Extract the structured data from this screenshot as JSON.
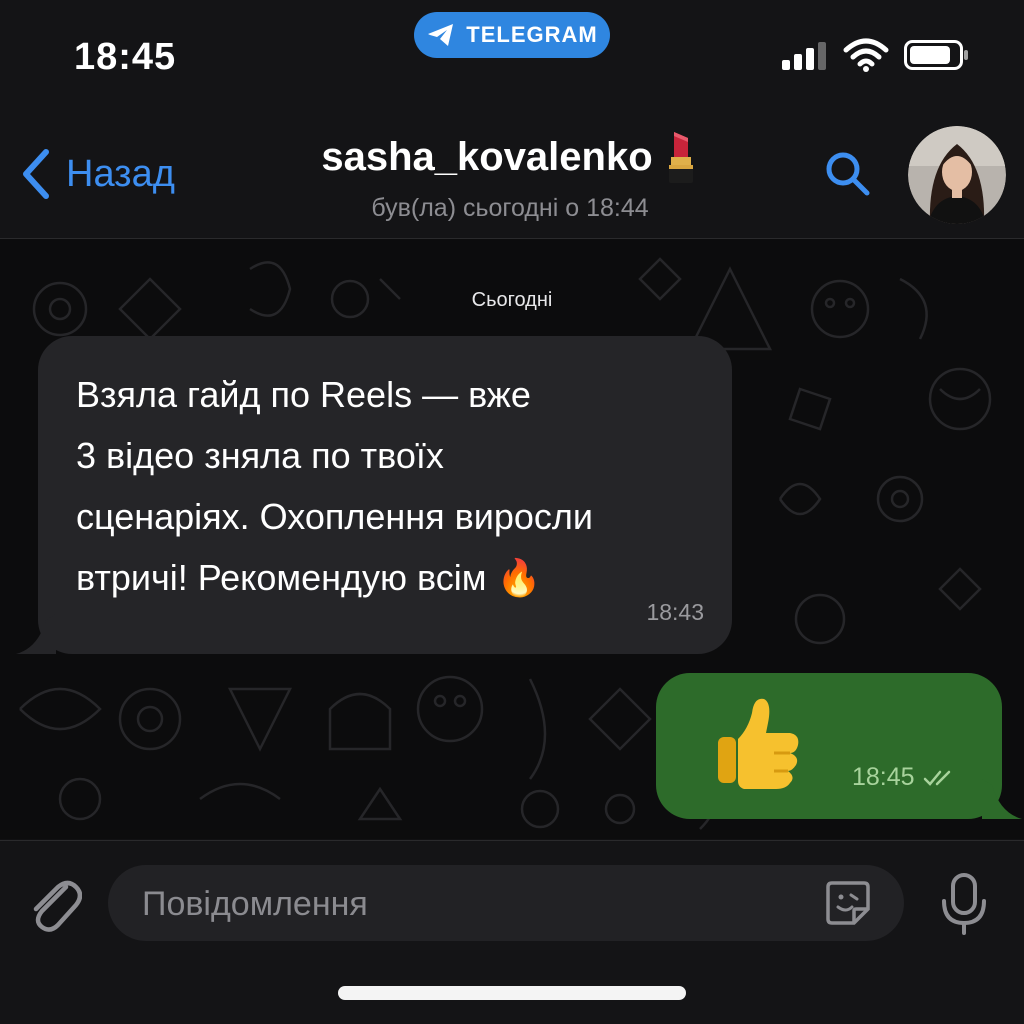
{
  "status_bar": {
    "time": "18:45",
    "app_pill": "TELEGRAM",
    "icons": [
      "telegram-icon",
      "signal-icon",
      "wifi-icon",
      "battery-icon"
    ]
  },
  "header": {
    "back_label": "Назад",
    "title": "sasha_kovalenko",
    "title_emoji": "💄",
    "subtitle": "був(ла) сьогодні о 18:44",
    "icons": [
      "chevron-left-icon",
      "search-icon",
      "avatar"
    ]
  },
  "chat": {
    "date_label": "Сьогодні",
    "messages": [
      {
        "direction": "incoming",
        "lines": [
          "Взяла гайд по Reels — вже",
          "3 відео зняла по твоїх",
          "сценаріях. Охоплення виросли",
          "втричі! Рекомендую всім 🔥"
        ],
        "time": "18:43"
      },
      {
        "direction": "outgoing",
        "content": "👍",
        "time": "18:45",
        "status_icon": "double-check-icon"
      }
    ]
  },
  "input": {
    "placeholder": "Повідомлення",
    "value": "",
    "icons": [
      "paperclip-icon",
      "sticker-icon",
      "microphone-icon"
    ]
  },
  "colors": {
    "accent": "#3d8ef0",
    "telegram_pill": "#2f86e0",
    "incoming_bubble": "#252528",
    "outgoing_bubble": "#2d6b2a",
    "outgoing_time": "#a8d39c",
    "background": "#0c0c0d"
  }
}
